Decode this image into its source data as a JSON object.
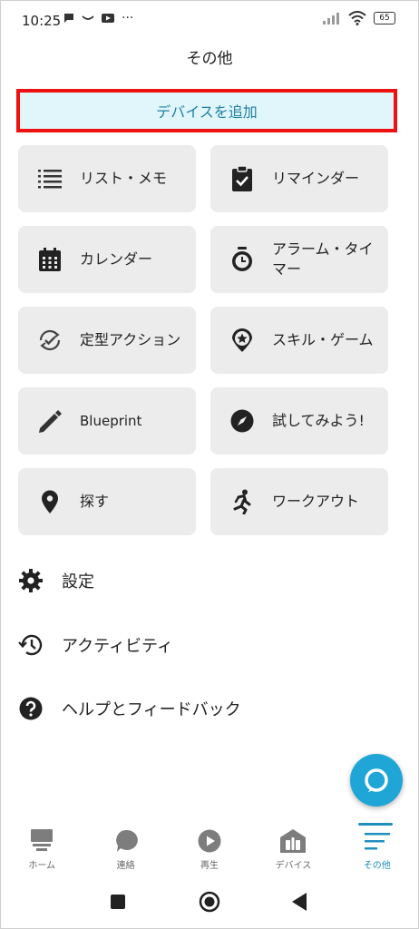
{
  "status": {
    "time": "10:25",
    "battery": "65"
  },
  "header": {
    "title": "その他"
  },
  "add_device": {
    "label": "デバイスを追加"
  },
  "tiles": [
    {
      "label": "リスト・メモ",
      "icon": "list-icon"
    },
    {
      "label": "リマインダー",
      "icon": "clipboard-check-icon"
    },
    {
      "label": "カレンダー",
      "icon": "calendar-icon"
    },
    {
      "label": "アラーム・タイマー",
      "icon": "alarm-clock-icon"
    },
    {
      "label": "定型アクション",
      "icon": "routine-icon"
    },
    {
      "label": "スキル・ゲーム",
      "icon": "skill-icon"
    },
    {
      "label": "Blueprint",
      "icon": "pen-icon"
    },
    {
      "label": "試してみよう!",
      "icon": "compass-icon"
    },
    {
      "label": "探す",
      "icon": "location-pin-icon"
    },
    {
      "label": "ワークアウト",
      "icon": "runner-icon"
    }
  ],
  "list": [
    {
      "label": "設定",
      "icon": "gear-icon"
    },
    {
      "label": "アクティビティ",
      "icon": "history-icon"
    },
    {
      "label": "ヘルプとフィードバック",
      "icon": "help-icon"
    }
  ],
  "bottom_nav": [
    {
      "label": "ホーム",
      "icon": "home-icon"
    },
    {
      "label": "連絡",
      "icon": "chat-icon"
    },
    {
      "label": "再生",
      "icon": "play-icon"
    },
    {
      "label": "デバイス",
      "icon": "devices-icon"
    },
    {
      "label": "その他",
      "icon": "menu-icon",
      "active": true
    }
  ],
  "colors": {
    "accent": "#1f8fbf",
    "highlight_border": "#ee1111",
    "tile_bg": "#ececec",
    "fab": "#1fa6d6"
  }
}
